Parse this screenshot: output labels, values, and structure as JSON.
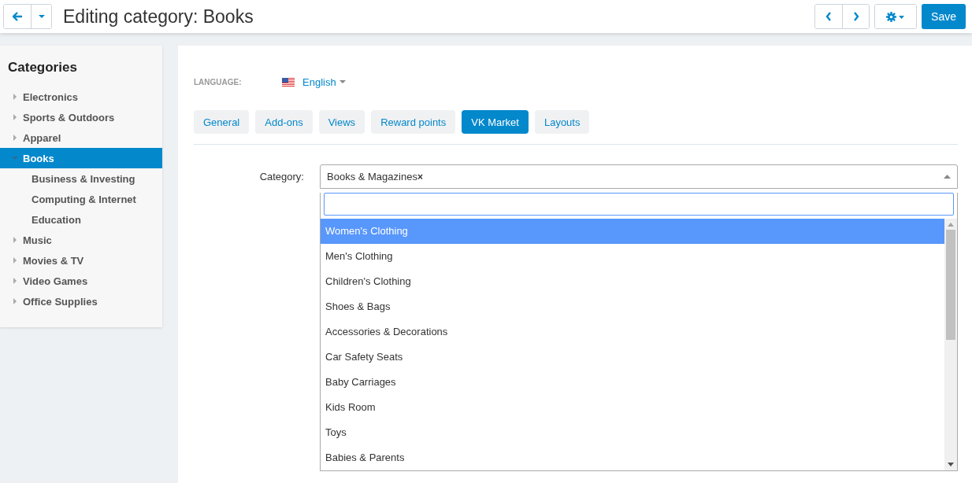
{
  "header": {
    "title": "Editing category: Books",
    "save": "Save"
  },
  "sidebar": {
    "title": "Categories",
    "items": [
      {
        "label": "Electronics",
        "selected": false,
        "expanded": false
      },
      {
        "label": "Sports & Outdoors",
        "selected": false,
        "expanded": false
      },
      {
        "label": "Apparel",
        "selected": false,
        "expanded": false
      },
      {
        "label": "Books",
        "selected": true,
        "expanded": true,
        "children": [
          {
            "label": "Business & Investing",
            "selected": false
          },
          {
            "label": "Computing & Internet",
            "selected": false
          },
          {
            "label": "Education",
            "selected": false
          }
        ]
      },
      {
        "label": "Music",
        "selected": false,
        "expanded": false
      },
      {
        "label": "Movies & TV",
        "selected": false,
        "expanded": false
      },
      {
        "label": "Video Games",
        "selected": false,
        "expanded": false
      },
      {
        "label": "Office Supplies",
        "selected": false,
        "expanded": false
      }
    ]
  },
  "language": {
    "label": "LANGUAGE:",
    "value": "English"
  },
  "tabs": [
    {
      "label": "General",
      "selected": false
    },
    {
      "label": "Add-ons",
      "selected": false
    },
    {
      "label": "Views",
      "selected": false
    },
    {
      "label": "Reward points",
      "selected": false
    },
    {
      "label": "VK Market",
      "selected": true
    },
    {
      "label": "Layouts",
      "selected": false
    }
  ],
  "category": {
    "label": "Category:",
    "value": "Books & Magazines",
    "clear": "×",
    "options": [
      {
        "label": "Women's Clothing",
        "selected": true
      },
      {
        "label": "Men's Clothing",
        "selected": false
      },
      {
        "label": "Children's Clothing",
        "selected": false
      },
      {
        "label": "Shoes & Bags",
        "selected": false
      },
      {
        "label": "Accessories & Decorations",
        "selected": false
      },
      {
        "label": "Car Safety Seats",
        "selected": false
      },
      {
        "label": "Baby Carriages",
        "selected": false
      },
      {
        "label": "Kids Room",
        "selected": false
      },
      {
        "label": "Toys",
        "selected": false
      },
      {
        "label": "Babies & Parents",
        "selected": false
      }
    ]
  }
}
